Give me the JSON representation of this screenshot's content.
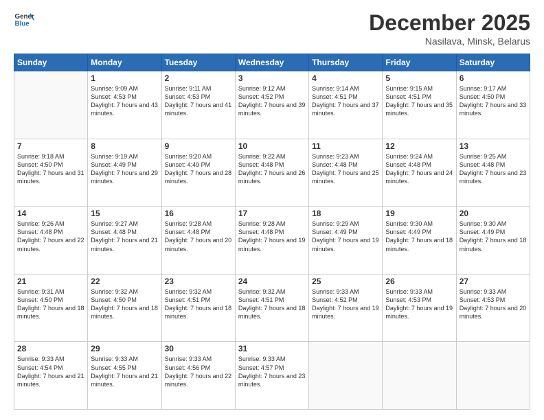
{
  "logo": {
    "line1": "General",
    "line2": "Blue"
  },
  "title": "December 2025",
  "subtitle": "Nasilava, Minsk, Belarus",
  "headers": [
    "Sunday",
    "Monday",
    "Tuesday",
    "Wednesday",
    "Thursday",
    "Friday",
    "Saturday"
  ],
  "weeks": [
    [
      {
        "day": "",
        "info": ""
      },
      {
        "day": "1",
        "info": "Sunrise: 9:09 AM\nSunset: 4:53 PM\nDaylight: 7 hours\nand 43 minutes."
      },
      {
        "day": "2",
        "info": "Sunrise: 9:11 AM\nSunset: 4:53 PM\nDaylight: 7 hours\nand 41 minutes."
      },
      {
        "day": "3",
        "info": "Sunrise: 9:12 AM\nSunset: 4:52 PM\nDaylight: 7 hours\nand 39 minutes."
      },
      {
        "day": "4",
        "info": "Sunrise: 9:14 AM\nSunset: 4:51 PM\nDaylight: 7 hours\nand 37 minutes."
      },
      {
        "day": "5",
        "info": "Sunrise: 9:15 AM\nSunset: 4:51 PM\nDaylight: 7 hours\nand 35 minutes."
      },
      {
        "day": "6",
        "info": "Sunrise: 9:17 AM\nSunset: 4:50 PM\nDaylight: 7 hours\nand 33 minutes."
      }
    ],
    [
      {
        "day": "7",
        "info": "Sunrise: 9:18 AM\nSunset: 4:50 PM\nDaylight: 7 hours\nand 31 minutes."
      },
      {
        "day": "8",
        "info": "Sunrise: 9:19 AM\nSunset: 4:49 PM\nDaylight: 7 hours\nand 29 minutes."
      },
      {
        "day": "9",
        "info": "Sunrise: 9:20 AM\nSunset: 4:49 PM\nDaylight: 7 hours\nand 28 minutes."
      },
      {
        "day": "10",
        "info": "Sunrise: 9:22 AM\nSunset: 4:48 PM\nDaylight: 7 hours\nand 26 minutes."
      },
      {
        "day": "11",
        "info": "Sunrise: 9:23 AM\nSunset: 4:48 PM\nDaylight: 7 hours\nand 25 minutes."
      },
      {
        "day": "12",
        "info": "Sunrise: 9:24 AM\nSunset: 4:48 PM\nDaylight: 7 hours\nand 24 minutes."
      },
      {
        "day": "13",
        "info": "Sunrise: 9:25 AM\nSunset: 4:48 PM\nDaylight: 7 hours\nand 23 minutes."
      }
    ],
    [
      {
        "day": "14",
        "info": "Sunrise: 9:26 AM\nSunset: 4:48 PM\nDaylight: 7 hours\nand 22 minutes."
      },
      {
        "day": "15",
        "info": "Sunrise: 9:27 AM\nSunset: 4:48 PM\nDaylight: 7 hours\nand 21 minutes."
      },
      {
        "day": "16",
        "info": "Sunrise: 9:28 AM\nSunset: 4:48 PM\nDaylight: 7 hours\nand 20 minutes."
      },
      {
        "day": "17",
        "info": "Sunrise: 9:28 AM\nSunset: 4:48 PM\nDaylight: 7 hours\nand 19 minutes."
      },
      {
        "day": "18",
        "info": "Sunrise: 9:29 AM\nSunset: 4:49 PM\nDaylight: 7 hours\nand 19 minutes."
      },
      {
        "day": "19",
        "info": "Sunrise: 9:30 AM\nSunset: 4:49 PM\nDaylight: 7 hours\nand 18 minutes."
      },
      {
        "day": "20",
        "info": "Sunrise: 9:30 AM\nSunset: 4:49 PM\nDaylight: 7 hours\nand 18 minutes."
      }
    ],
    [
      {
        "day": "21",
        "info": "Sunrise: 9:31 AM\nSunset: 4:50 PM\nDaylight: 7 hours\nand 18 minutes."
      },
      {
        "day": "22",
        "info": "Sunrise: 9:32 AM\nSunset: 4:50 PM\nDaylight: 7 hours\nand 18 minutes."
      },
      {
        "day": "23",
        "info": "Sunrise: 9:32 AM\nSunset: 4:51 PM\nDaylight: 7 hours\nand 18 minutes."
      },
      {
        "day": "24",
        "info": "Sunrise: 9:32 AM\nSunset: 4:51 PM\nDaylight: 7 hours\nand 18 minutes."
      },
      {
        "day": "25",
        "info": "Sunrise: 9:33 AM\nSunset: 4:52 PM\nDaylight: 7 hours\nand 19 minutes."
      },
      {
        "day": "26",
        "info": "Sunrise: 9:33 AM\nSunset: 4:53 PM\nDaylight: 7 hours\nand 19 minutes."
      },
      {
        "day": "27",
        "info": "Sunrise: 9:33 AM\nSunset: 4:53 PM\nDaylight: 7 hours\nand 20 minutes."
      }
    ],
    [
      {
        "day": "28",
        "info": "Sunrise: 9:33 AM\nSunset: 4:54 PM\nDaylight: 7 hours\nand 21 minutes."
      },
      {
        "day": "29",
        "info": "Sunrise: 9:33 AM\nSunset: 4:55 PM\nDaylight: 7 hours\nand 21 minutes."
      },
      {
        "day": "30",
        "info": "Sunrise: 9:33 AM\nSunset: 4:56 PM\nDaylight: 7 hours\nand 22 minutes."
      },
      {
        "day": "31",
        "info": "Sunrise: 9:33 AM\nSunset: 4:57 PM\nDaylight: 7 hours\nand 23 minutes."
      },
      {
        "day": "",
        "info": ""
      },
      {
        "day": "",
        "info": ""
      },
      {
        "day": "",
        "info": ""
      }
    ]
  ]
}
